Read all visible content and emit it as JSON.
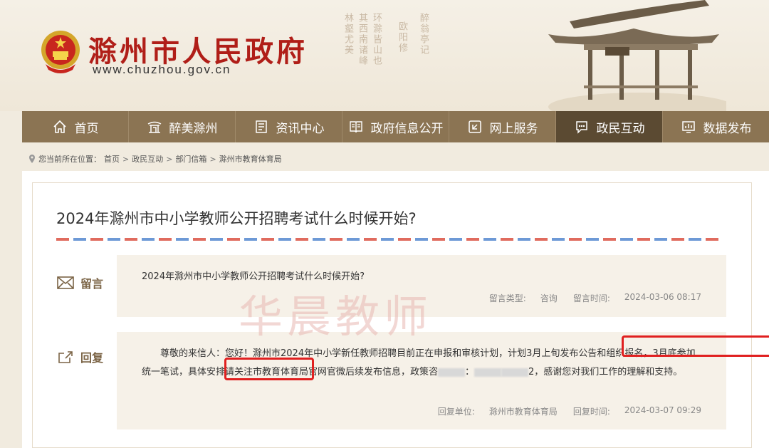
{
  "header": {
    "site_title": "滁州市人民政府",
    "site_url": "www.chuzhou.gov.cn",
    "calligraphy": [
      "醉翁亭记",
      "欧阳修",
      "环滁皆山也",
      "其西南诸峰",
      "林壑尤美"
    ]
  },
  "nav": {
    "items": [
      {
        "label": "首页",
        "icon": "home-icon"
      },
      {
        "label": "醉美滁州",
        "icon": "pavilion-icon"
      },
      {
        "label": "资讯中心",
        "icon": "news-icon"
      },
      {
        "label": "政府信息公开",
        "icon": "book-icon"
      },
      {
        "label": "网上服务",
        "icon": "service-icon"
      },
      {
        "label": "政民互动",
        "icon": "chat-icon",
        "active": true
      },
      {
        "label": "数据发布",
        "icon": "chart-icon"
      }
    ]
  },
  "breadcrumb": {
    "prefix": "您当前所在位置：",
    "items": [
      "首页",
      "政民互动",
      "部门信箱",
      "滁州市教育体育局"
    ],
    "separator": ">"
  },
  "message": {
    "title": "2024年滁州市中小学教师公开招聘考试什么时候开始?",
    "label": "留言",
    "content": "2024年滁州市中小学教师公开招聘考试什么时候开始?",
    "type_label": "留言类型:",
    "type_value": "咨询",
    "time_label": "留言时间:",
    "time_value": "2024-03-06 08:17"
  },
  "reply": {
    "label": "回复",
    "text_part1": "尊敬的来信人：您好！滁州市2024年中小学新任教师招聘目前正在申报和审核计划，计划3月上旬发布公告和组织报名，3月底参加统一笔试，具体安排请关注市教育体育局官网官微后续发布信息，政策咨",
    "text_part2": "：",
    "text_part3": "2，感谢您对我们工作的理解和支持。",
    "unit_label": "回复单位:",
    "unit_value": "滁州市教育体育局",
    "time_label": "回复时间:",
    "time_value": "2024-03-07 09:29"
  },
  "watermark": "华晨教师",
  "colors": {
    "nav_bg": "#8b7453",
    "nav_active": "#5b4a32",
    "title_red": "#b01e18",
    "highlight": "#e02020"
  }
}
